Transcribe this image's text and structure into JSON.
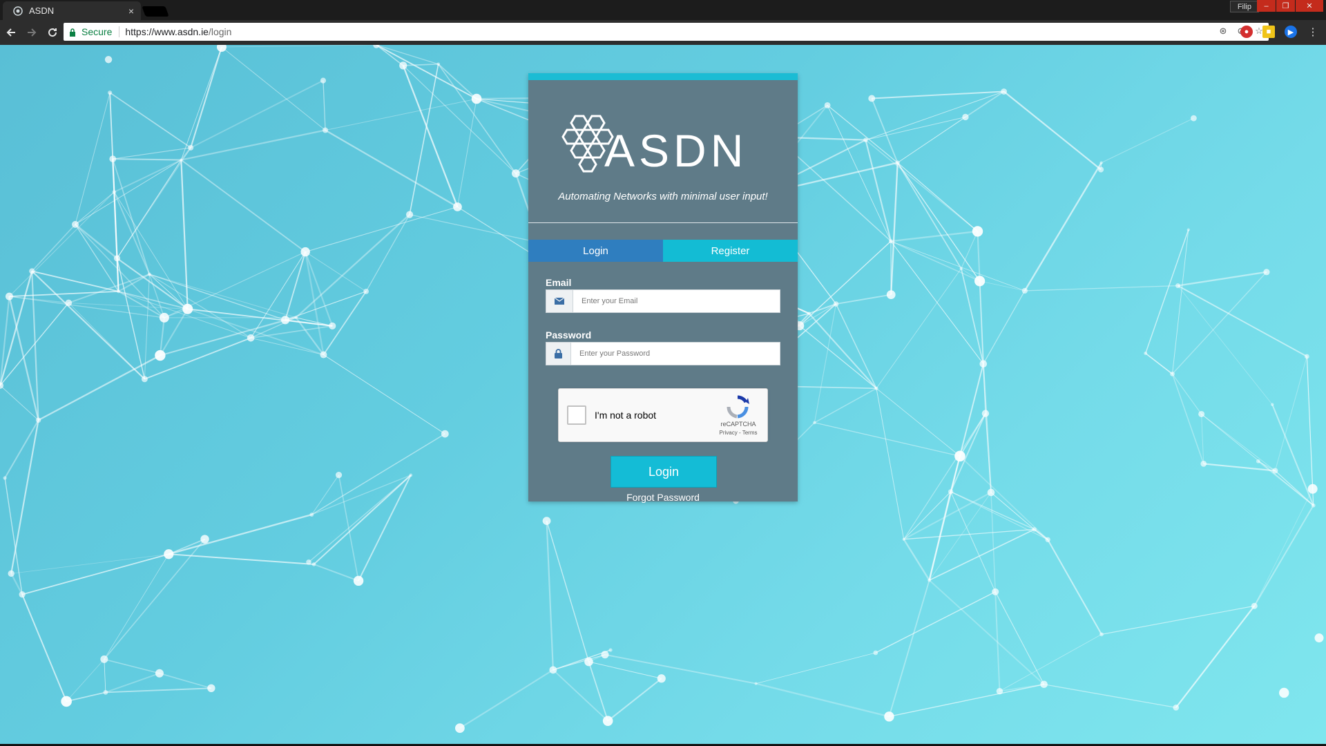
{
  "browser": {
    "tab_title": "ASDN",
    "tab_close": "×",
    "profile_name": "Filip",
    "window_controls": {
      "minimize": "–",
      "maximize": "❐",
      "close": "✕"
    },
    "secure_label": "Secure",
    "url_host": "https://www.asdn.ie",
    "url_path": "/login"
  },
  "page": {
    "logo_text": "ASDN",
    "tagline": "Automating Networks with minimal user input!",
    "tabs": {
      "login": "Login",
      "register": "Register"
    },
    "email": {
      "label": "Email",
      "placeholder": "Enter your Email"
    },
    "password": {
      "label": "Password",
      "placeholder": "Enter your Password"
    },
    "recaptcha": {
      "label": "I'm not a robot",
      "brand": "reCAPTCHA",
      "links": "Privacy - Terms"
    },
    "login_button": "Login",
    "forgot_password": "Forgot Password"
  },
  "colors": {
    "card_bg": "#5f7b88",
    "card_accent": "#1bbcd4",
    "tab_login_bg": "#2f7ebf",
    "tab_register_bg": "#13bcd4",
    "login_button_bg": "#14bcd6",
    "secure_green": "#0b8043"
  }
}
